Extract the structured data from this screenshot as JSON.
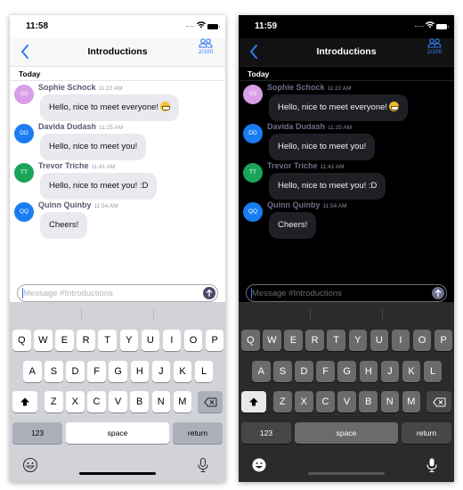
{
  "colors": {
    "accent": "#2f7cf6",
    "avatar_ss": "#d89ee6",
    "avatar_dd": "#1a7cf3",
    "avatar_tt": "#1aa45a",
    "avatar_qq": "#1a7cf3"
  },
  "screens": [
    {
      "theme": "light",
      "status": {
        "time": "11:58"
      },
      "nav": {
        "back_icon": "chevron-left-icon",
        "title": "Introductions",
        "members_icon": "people-icon",
        "member_count": "2/100"
      },
      "date_header": "Today",
      "messages": [
        {
          "initials": "SS",
          "name": "Sophie Schock",
          "time": "11:22 AM",
          "text": "Hello, nice to meet everyone!",
          "emoji": "grinning-face"
        },
        {
          "initials": "DD",
          "name": "Davida Dudash",
          "time": "11:25 AM",
          "text": "Hello, nice to meet you!"
        },
        {
          "initials": "TT",
          "name": "Trevor Triche",
          "time": "11:41 AM",
          "text": "Hello, nice to meet you! :D"
        },
        {
          "initials": "QQ",
          "name": "Quinn Quinby",
          "time": "11:54 AM",
          "text": "Cheers!"
        }
      ],
      "composer": {
        "placeholder": "Message #Introductions",
        "value": "",
        "send_icon": "arrow-up-icon"
      }
    },
    {
      "theme": "dark",
      "status": {
        "time": "11:59"
      },
      "nav": {
        "back_icon": "chevron-left-icon",
        "title": "Introductions",
        "members_icon": "people-icon",
        "member_count": "2/100"
      },
      "date_header": "Today",
      "messages": [
        {
          "initials": "SS",
          "name": "Sophie Schock",
          "time": "11:22 AM",
          "text": "Hello, nice to meet everyone!",
          "emoji": "grinning-face"
        },
        {
          "initials": "DD",
          "name": "Davida Dudash",
          "time": "11:25 AM",
          "text": "Hello, nice to meet you!"
        },
        {
          "initials": "TT",
          "name": "Trevor Triche",
          "time": "11:41 AM",
          "text": "Hello, nice to meet you! :D"
        },
        {
          "initials": "QQ",
          "name": "Quinn Quinby",
          "time": "11:54 AM",
          "text": "Cheers!"
        }
      ],
      "composer": {
        "placeholder": "Message #Introductions",
        "value": "",
        "send_icon": "arrow-up-icon"
      }
    }
  ],
  "keyboard": {
    "row1": [
      "Q",
      "W",
      "E",
      "R",
      "T",
      "Y",
      "U",
      "I",
      "O",
      "P"
    ],
    "row2": [
      "A",
      "S",
      "D",
      "F",
      "G",
      "H",
      "J",
      "K",
      "L"
    ],
    "row3": [
      "Z",
      "X",
      "C",
      "V",
      "B",
      "N",
      "M"
    ],
    "shift_icon": "shift-icon",
    "delete_icon": "backspace-icon",
    "numbers_label": "123",
    "space_label": "space",
    "return_label": "return",
    "emoji_icon": "emoji-icon",
    "mic_icon": "microphone-icon"
  }
}
